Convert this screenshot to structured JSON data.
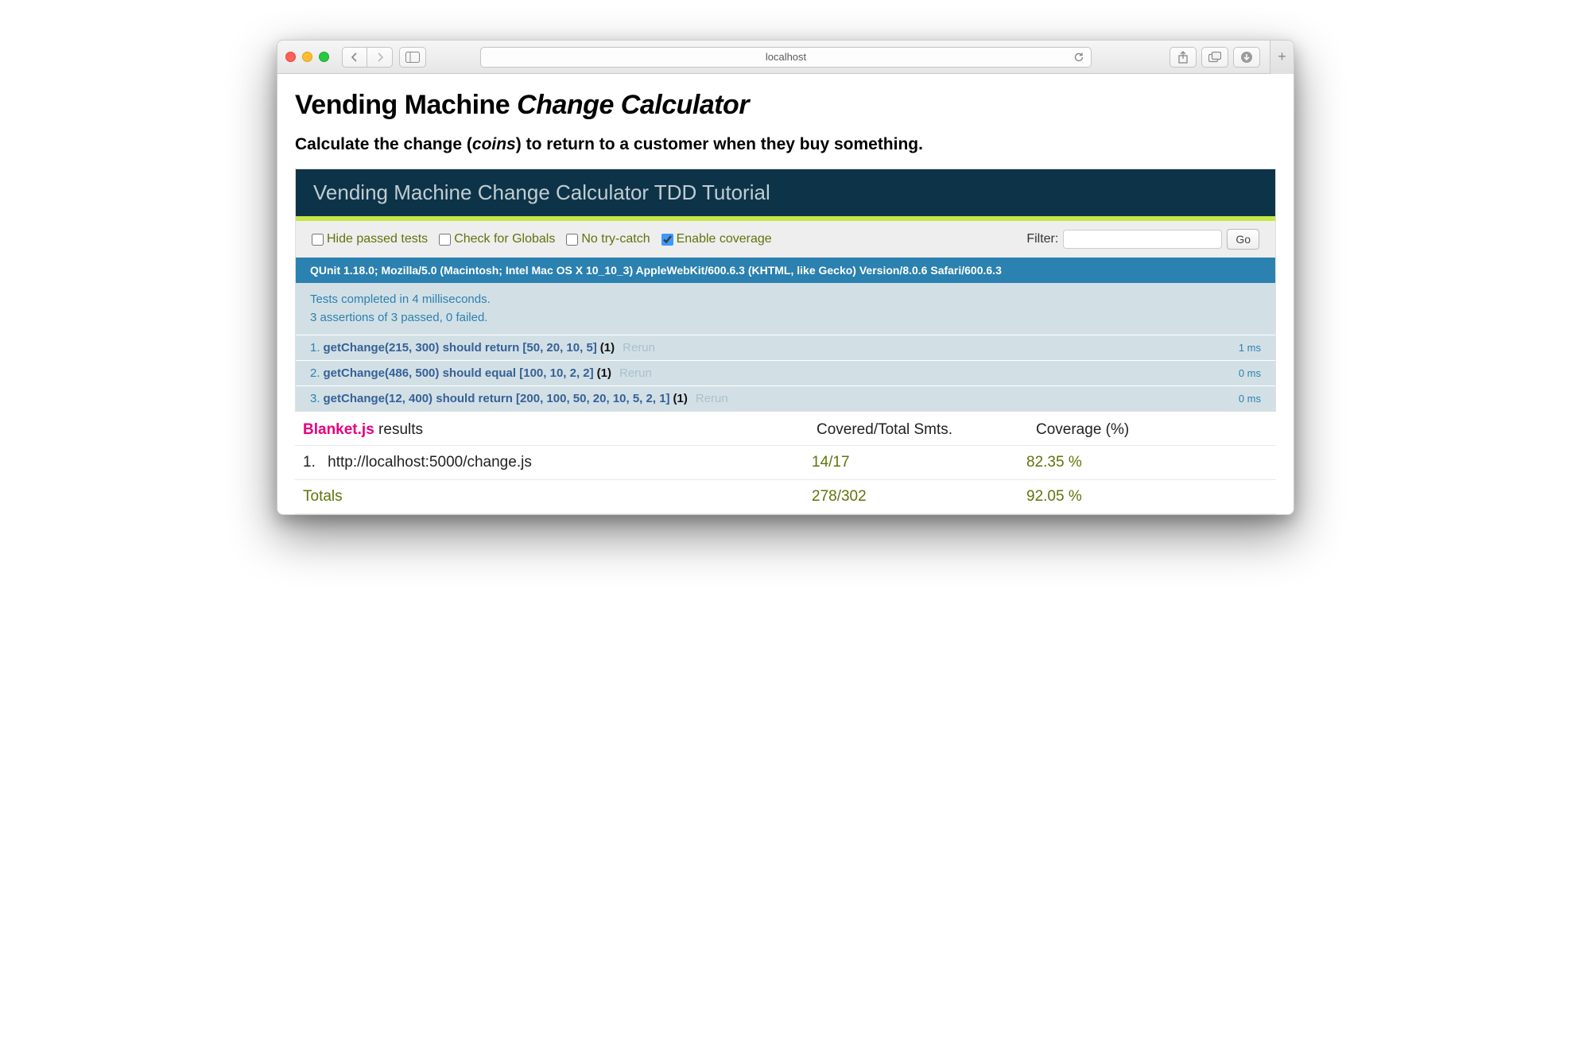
{
  "browser": {
    "url_display": "localhost"
  },
  "page": {
    "title_prefix": "Vending Machine ",
    "title_em": "Change Calculator",
    "subtitle_before": "Calculate the change (",
    "subtitle_em": "coins",
    "subtitle_after": ") to return to a customer when they buy something."
  },
  "qunit": {
    "header": "Vending Machine Change Calculator TDD Tutorial",
    "toolbar": {
      "hide_passed": "Hide passed tests",
      "check_globals": "Check for Globals",
      "no_trycatch": "No try-catch",
      "enable_coverage": "Enable coverage",
      "filter_label": "Filter:",
      "go_label": "Go"
    },
    "user_agent": "QUnit 1.18.0; Mozilla/5.0 (Macintosh; Intel Mac OS X 10_10_3) AppleWebKit/600.6.3 (KHTML, like Gecko) Version/8.0.6 Safari/600.6.3",
    "summary_line1": "Tests completed in 4 milliseconds.",
    "summary_line2": "3 assertions of 3 passed, 0 failed.",
    "tests": [
      {
        "num": "1.",
        "name": "getChange(215, 300) should return [50, 20, 10, 5]",
        "count": "(1)",
        "rerun": "Rerun",
        "time": "1 ms"
      },
      {
        "num": "2.",
        "name": "getChange(486, 500) should equal [100, 10, 2, 2]",
        "count": "(1)",
        "rerun": "Rerun",
        "time": "0 ms"
      },
      {
        "num": "3.",
        "name": "getChange(12, 400) should return [200, 100, 50, 20, 10, 5, 2, 1]",
        "count": "(1)",
        "rerun": "Rerun",
        "time": "0 ms"
      }
    ]
  },
  "blanket": {
    "brand": "Blanket.js",
    "results_label": " results",
    "col_covered": "Covered/Total Smts.",
    "col_coverage": "Coverage (%)",
    "rows": [
      {
        "idx": "1.",
        "file": "http://localhost:5000/change.js",
        "covered": "14/17",
        "pct": "82.35 %"
      }
    ],
    "totals_label": "Totals",
    "totals_covered": "278/302",
    "totals_pct": "92.05 %"
  }
}
